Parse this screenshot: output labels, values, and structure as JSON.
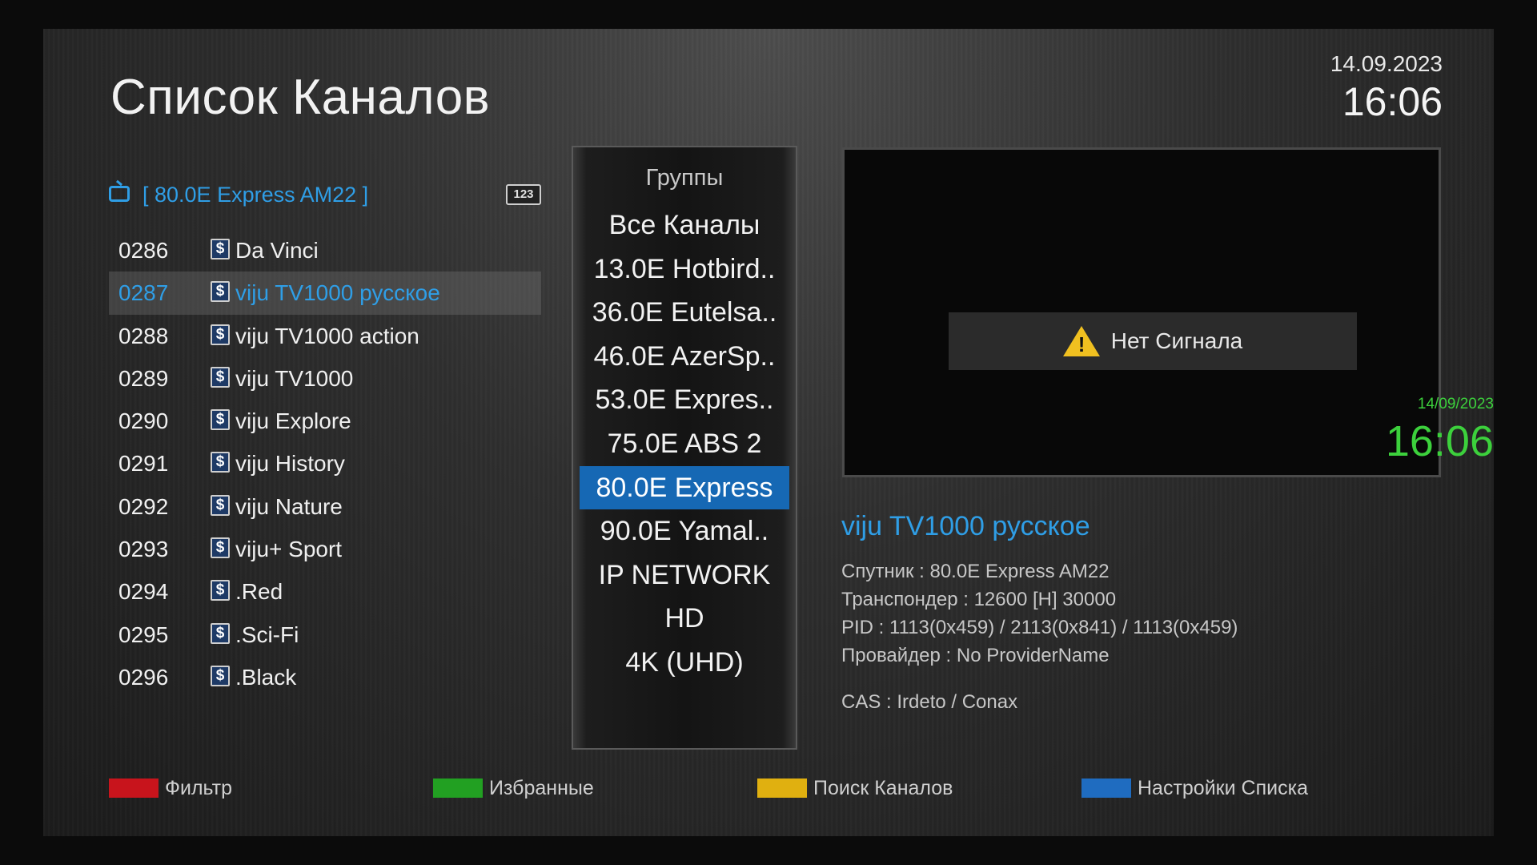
{
  "header": {
    "title": "Список Каналов",
    "date": "14.09.2023",
    "time": "16:06"
  },
  "channel_list": {
    "satellite": "[ 80.0E Express AM22 ]",
    "sort_badge": "123",
    "scrambled_symbol": "$",
    "channels": [
      {
        "number": "0286",
        "name": "Da Vinci"
      },
      {
        "number": "0287",
        "name": "viju TV1000 русское",
        "selected": true
      },
      {
        "number": "0288",
        "name": "viju TV1000 action"
      },
      {
        "number": "0289",
        "name": "viju TV1000"
      },
      {
        "number": "0290",
        "name": "viju Explore"
      },
      {
        "number": "0291",
        "name": "viju History"
      },
      {
        "number": "0292",
        "name": "viju Nature"
      },
      {
        "number": "0293",
        "name": "viju+ Sport"
      },
      {
        "number": "0294",
        "name": ".Red"
      },
      {
        "number": "0295",
        "name": ".Sci-Fi"
      },
      {
        "number": "0296",
        "name": ".Black"
      }
    ]
  },
  "groups": {
    "title": "Группы",
    "items": [
      "Все Каналы",
      "13.0E Hotbird..",
      "36.0E Eutelsa..",
      "46.0E AzerSp..",
      "53.0E Expres..",
      "75.0E ABS 2",
      "80.0E Express",
      "90.0E Yamal..",
      "IP NETWORK",
      "HD",
      "4K (UHD)"
    ],
    "selected_index": 6
  },
  "preview": {
    "no_signal_text": "Нет Сигнала",
    "warning_icon": "warning-icon",
    "clock_date": "14/09/2023",
    "clock_time": "16:06",
    "clock_color": "#3cd03c"
  },
  "info": {
    "channel_name": "viju TV1000 русское",
    "satellite": "Спутник : 80.0E Express AM22",
    "transponder": "Транспондер : 12600 [H] 30000",
    "pid": "PID : 1113(0x459) / 2113(0x841) / 1113(0x459)",
    "provider": "Провайдер : No ProviderName",
    "cas": "CAS : Irdeto / Conax"
  },
  "keys": [
    {
      "label": "Фильтр",
      "color": "#c8141c"
    },
    {
      "label": "Избранные",
      "color": "#22a022"
    },
    {
      "label": "Поиск Каналов",
      "color": "#e0b010"
    },
    {
      "label": "Настройки Списка",
      "color": "#1f6cc0"
    }
  ],
  "accent_color": "#2f9ee6",
  "selection_color": "#1668b4"
}
